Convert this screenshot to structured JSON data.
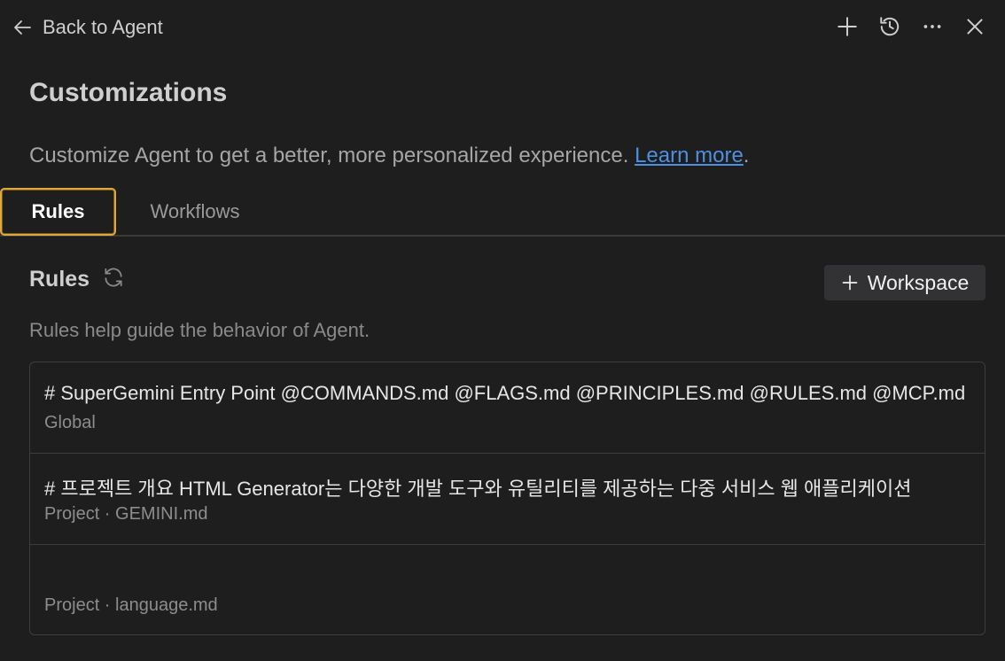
{
  "header": {
    "back_label": "Back to Agent",
    "icons": [
      "arrow-left-icon",
      "plus-icon",
      "history-icon",
      "more-icon",
      "close-icon"
    ]
  },
  "page": {
    "title": "Customizations",
    "description": "Customize Agent to get a better, more personalized experience. ",
    "learn_more": "Learn more",
    "period": "."
  },
  "tabs": [
    {
      "label": "Rules",
      "active": true
    },
    {
      "label": "Workflows",
      "active": false
    }
  ],
  "rules": {
    "title": "Rules",
    "description": "Rules help guide the behavior of Agent.",
    "add_button": "Workspace",
    "items": [
      {
        "title": "# SuperGemini Entry Point @COMMANDS.md @FLAGS.md @PRINCIPLES.md @RULES.md @MCP.md",
        "subtitle": "Global"
      },
      {
        "title": "# 프로젝트 개요 HTML Generator는 다양한 개발 도구와 유틸리티를 제공하는 다중 서비스 웹 애플리케이션",
        "subtitle": "Project · GEMINI.md"
      },
      {
        "title": "",
        "subtitle": "Project · language.md"
      }
    ]
  },
  "colors": {
    "accent_border": "#e0a73a",
    "link": "#4d8fe0",
    "background": "#1e1e1f"
  }
}
